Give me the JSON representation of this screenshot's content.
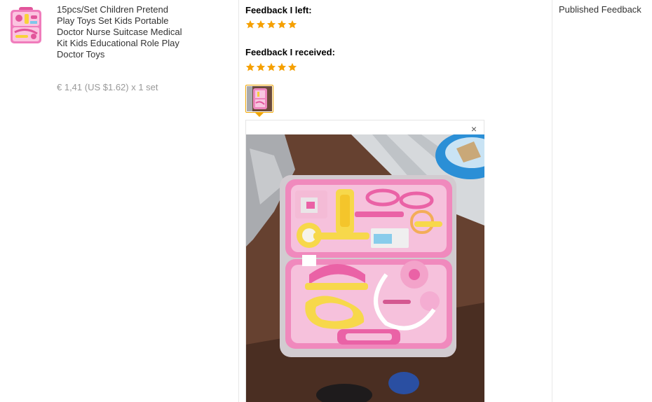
{
  "product": {
    "title": "15pcs/Set Children Pretend Play Toys Set Kids Portable Doctor Nurse Suitcase Medical Kit Kids Educational Role Play Doctor Toys",
    "price": "€ 1,41 (US $1.62) x 1 set",
    "thumbnail_icon": "doctor-kit-product-image"
  },
  "feedback": {
    "left_label": "Feedback I left:",
    "left_rating": 5,
    "received_label": "Feedback I received:",
    "received_rating": 5,
    "star_color": "#f5a000",
    "close_symbol": "×",
    "selected_border_color": "#f0a500"
  },
  "status": {
    "label": "Published Feedback"
  }
}
